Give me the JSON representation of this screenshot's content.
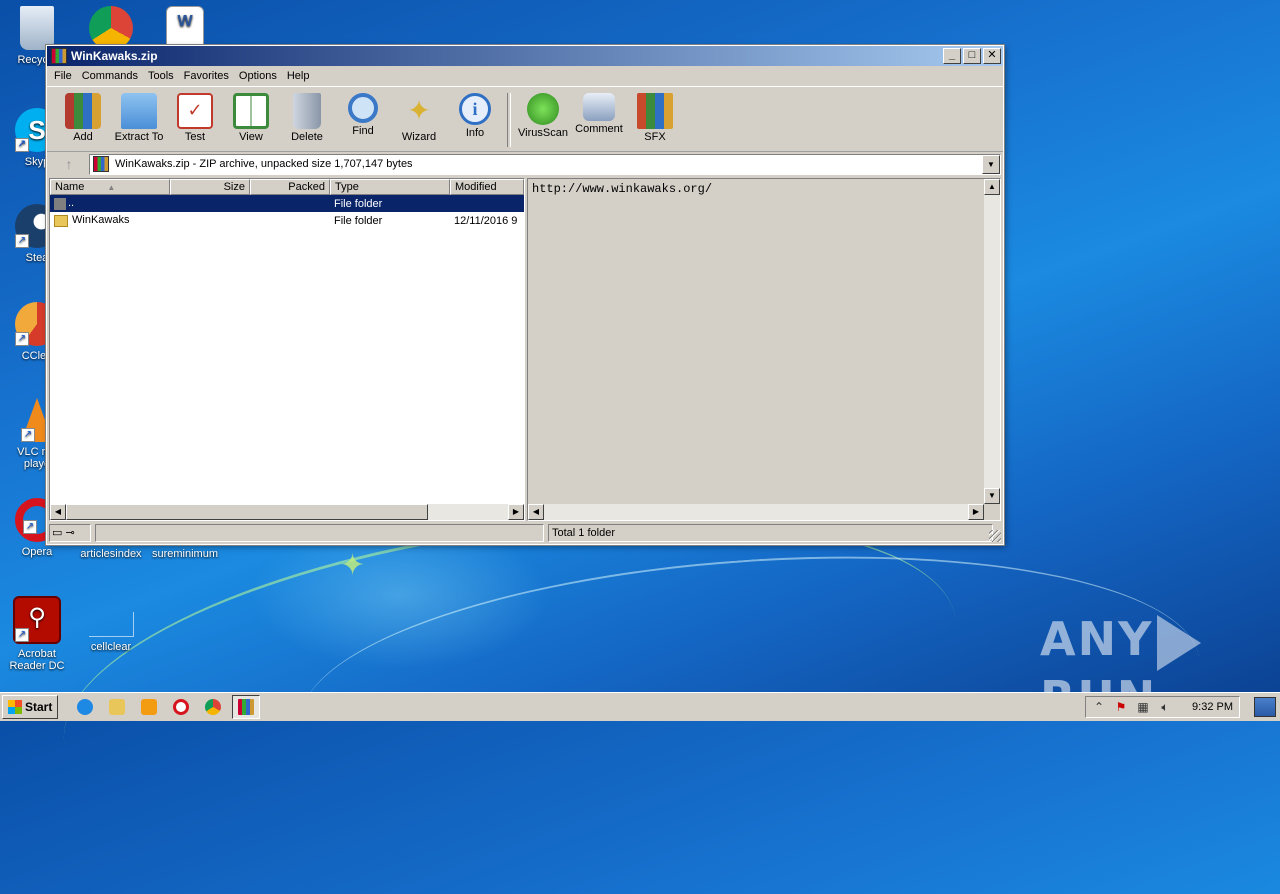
{
  "desktop": {
    "icons": [
      {
        "label": "Recycle"
      },
      {
        "label": "Skyp"
      },
      {
        "label": "Stea"
      },
      {
        "label": "CClea"
      },
      {
        "label": "VLC me\nplaye"
      },
      {
        "label": "Opera"
      },
      {
        "label": "Acrobat Reader DC"
      },
      {
        "label": "articlesindex"
      },
      {
        "label": "sureminimum"
      },
      {
        "label": "cellclear"
      }
    ],
    "watermark": "ANY RUN",
    "watermark_left": "ANY",
    "watermark_right": "RUN"
  },
  "window": {
    "title": "WinKawaks.zip",
    "buttons": {
      "minimize": "_",
      "maximize": "□",
      "close": "✕"
    },
    "menu": [
      "File",
      "Commands",
      "Tools",
      "Favorites",
      "Options",
      "Help"
    ],
    "toolbar": [
      {
        "label": "Add",
        "icon": "add-icon",
        "color": "#b33a2e"
      },
      {
        "label": "Extract To",
        "icon": "extract-icon",
        "color": "#4a8fd8"
      },
      {
        "label": "Test",
        "icon": "test-icon",
        "color": "#c0392b"
      },
      {
        "label": "View",
        "icon": "view-icon",
        "color": "#3c8a3c"
      },
      {
        "label": "Delete",
        "icon": "delete-icon",
        "color": "#8a96a8"
      },
      {
        "label": "Find",
        "icon": "find-icon",
        "color": "#3a78c8"
      },
      {
        "label": "Wizard",
        "icon": "wizard-icon",
        "color": "#d9b232"
      },
      {
        "label": "Info",
        "icon": "info-icon",
        "color": "#2f6fc4"
      },
      {
        "label": "VirusScan",
        "icon": "virusscan-icon",
        "color": "#3aa02e"
      },
      {
        "label": "Comment",
        "icon": "comment-icon",
        "color": "#8aa0bf"
      },
      {
        "label": "SFX",
        "icon": "sfx-icon",
        "color": "#c74a2c"
      }
    ],
    "address": {
      "up_label": "↑",
      "text": "WinKawaks.zip - ZIP archive, unpacked size 1,707,147 bytes"
    },
    "columns": {
      "name": "Name",
      "size": "Size",
      "packed": "Packed",
      "type": "Type",
      "modified": "Modified"
    },
    "rows": [
      {
        "name": "..",
        "size": "",
        "packed": "",
        "type": "File folder",
        "modified": ""
      },
      {
        "name": "WinKawaks",
        "size": "",
        "packed": "",
        "type": "File folder",
        "modified": "12/11/2016 9"
      }
    ],
    "comment": "http://www.winkawaks.org/",
    "status": {
      "total": "Total 1 folder"
    }
  },
  "taskbar": {
    "start_label": "Start",
    "clock": "9:32 PM"
  }
}
